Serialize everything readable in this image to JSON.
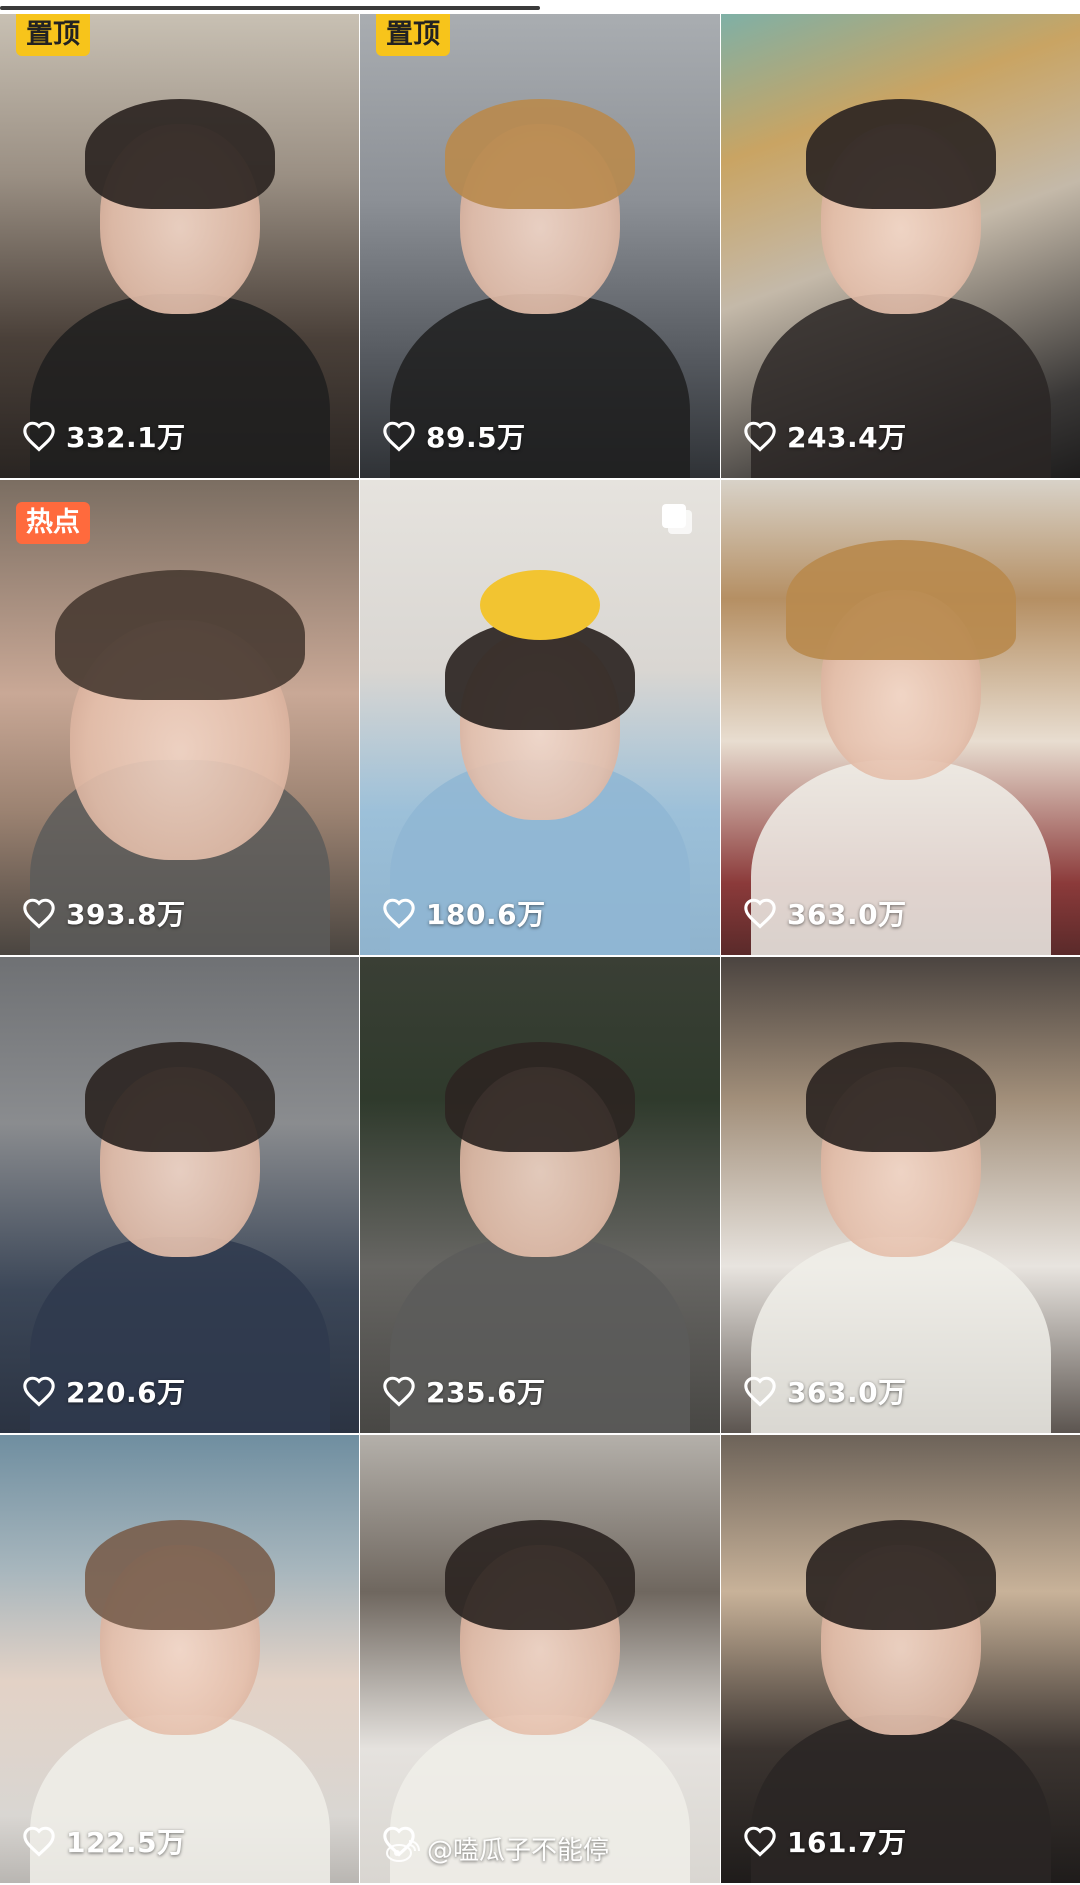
{
  "page": {
    "top_scroll_indicator": true
  },
  "videos": [
    {
      "likes": "332.1万",
      "badge": "置顶",
      "badge_type": "pinned"
    },
    {
      "likes": "89.5万",
      "badge": "置顶",
      "badge_type": "pinned"
    },
    {
      "likes": "243.4万"
    },
    {
      "likes": "393.8万",
      "badge": "热点",
      "badge_type": "hot"
    },
    {
      "likes": "180.6万",
      "icon": "multi-image-icon"
    },
    {
      "likes": "363.0万"
    },
    {
      "likes": "220.6万"
    },
    {
      "likes": "235.6万"
    },
    {
      "likes": "363.0万"
    },
    {
      "likes": "122.5万"
    },
    {
      "likes": "",
      "watermark": "@嗑瓜子不能停"
    },
    {
      "likes": "161.7万"
    }
  ],
  "colors": {
    "pinned_badge_bg": "#f7c41b",
    "hot_badge_bg": "#ff6a3d",
    "like_text": "#ffffff"
  }
}
